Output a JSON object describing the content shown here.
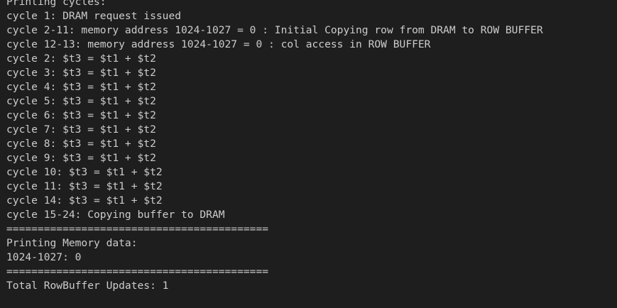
{
  "terminal": {
    "lines": [
      "Printing cycles:",
      "cycle 1: DRAM request issued",
      "cycle 2-11: memory address 1024-1027 = 0 : Initial Copying row from DRAM to ROW BUFFER",
      "cycle 12-13: memory address 1024-1027 = 0 : col access in ROW BUFFER",
      "cycle 2: $t3 = $t1 + $t2",
      "cycle 3: $t3 = $t1 + $t2",
      "cycle 4: $t3 = $t1 + $t2",
      "cycle 5: $t3 = $t1 + $t2",
      "cycle 6: $t3 = $t1 + $t2",
      "cycle 7: $t3 = $t1 + $t2",
      "cycle 8: $t3 = $t1 + $t2",
      "cycle 9: $t3 = $t1 + $t2",
      "cycle 10: $t3 = $t1 + $t2",
      "cycle 11: $t3 = $t1 + $t2",
      "cycle 14: $t3 = $t1 + $t2",
      "cycle 15-24: Copying buffer to DRAM",
      "==========================================",
      "Printing Memory data:",
      "1024-1027: 0",
      "==========================================",
      "Total RowBuffer Updates: 1"
    ],
    "colors": {
      "background": "#1e1e1e",
      "text": "#cccccc"
    }
  }
}
